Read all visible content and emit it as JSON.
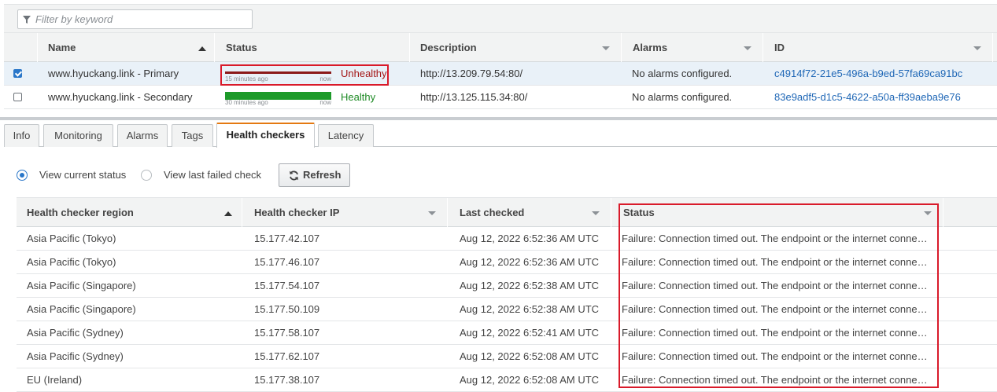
{
  "filter": {
    "placeholder": "Filter by keyword",
    "icon": "funnel-icon"
  },
  "top_table": {
    "columns": [
      "Name",
      "Status",
      "Description",
      "Alarms",
      "ID"
    ],
    "rows": [
      {
        "selected": true,
        "name": "www.hyuckang.link - Primary",
        "spark_left": "15 minutes ago",
        "spark_right": "now",
        "status": "Unhealthy",
        "status_color": "#8b1a1a",
        "status_text_color": "#a31515",
        "description": "http://13.209.79.54:80/",
        "alarms": "No alarms configured.",
        "id": "c4914f72-21e5-496a-b9ed-57fa69ca91bc"
      },
      {
        "selected": false,
        "name": "www.hyuckang.link - Secondary",
        "spark_left": "30 minutes ago",
        "spark_right": "now",
        "status": "Healthy",
        "status_color": "#1d9a2a",
        "status_text_color": "#1d8a24",
        "description": "http://13.125.115.34:80/",
        "alarms": "No alarms configured.",
        "id": "83e9adf5-d1c5-4622-a50a-ff39aeba9e76"
      }
    ]
  },
  "tabs": [
    {
      "label": "Info",
      "active": false
    },
    {
      "label": "Monitoring",
      "active": false
    },
    {
      "label": "Alarms",
      "active": false
    },
    {
      "label": "Tags",
      "active": false
    },
    {
      "label": "Health checkers",
      "active": true
    },
    {
      "label": "Latency",
      "active": false
    }
  ],
  "view_options": {
    "current": "View current status",
    "last_failed": "View last failed check",
    "selected": "current"
  },
  "refresh_label": "Refresh",
  "hc_table": {
    "columns": [
      "Health checker region",
      "Health checker IP",
      "Last checked",
      "Status"
    ],
    "rows": [
      {
        "region": "Asia Pacific (Tokyo)",
        "ip": "15.177.42.107",
        "last_checked": "Aug 12, 2022 6:52:36 AM UTC",
        "status": "Failure: Connection timed out. The endpoint or the internet connection is down, or requests are being blocked by your firewall."
      },
      {
        "region": "Asia Pacific (Tokyo)",
        "ip": "15.177.46.107",
        "last_checked": "Aug 12, 2022 6:52:36 AM UTC",
        "status": "Failure: Connection timed out. The endpoint or the internet connection is down, or requests are being blocked by your firewall."
      },
      {
        "region": "Asia Pacific (Singapore)",
        "ip": "15.177.54.107",
        "last_checked": "Aug 12, 2022 6:52:38 AM UTC",
        "status": "Failure: Connection timed out. The endpoint or the internet connection is down, or requests are being blocked by your firewall."
      },
      {
        "region": "Asia Pacific (Singapore)",
        "ip": "15.177.50.109",
        "last_checked": "Aug 12, 2022 6:52:38 AM UTC",
        "status": "Failure: Connection timed out. The endpoint or the internet connection is down, or requests are being blocked by your firewall."
      },
      {
        "region": "Asia Pacific (Sydney)",
        "ip": "15.177.58.107",
        "last_checked": "Aug 12, 2022 6:52:41 AM UTC",
        "status": "Failure: Connection timed out. The endpoint or the internet connection is down, or requests are being blocked by your firewall."
      },
      {
        "region": "Asia Pacific (Sydney)",
        "ip": "15.177.62.107",
        "last_checked": "Aug 12, 2022 6:52:08 AM UTC",
        "status": "Failure: Connection timed out. The endpoint or the internet connection is down, or requests are being blocked by your firewall."
      },
      {
        "region": "EU (Ireland)",
        "ip": "15.177.38.107",
        "last_checked": "Aug 12, 2022 6:52:08 AM UTC",
        "status": "Failure: Connection timed out. The endpoint or the internet connection is down, or requests are being blocked by your firewall."
      }
    ]
  },
  "colors": {
    "link": "#1f67b6",
    "highlight": "#d91a2a",
    "tab_accent": "#e47911"
  }
}
